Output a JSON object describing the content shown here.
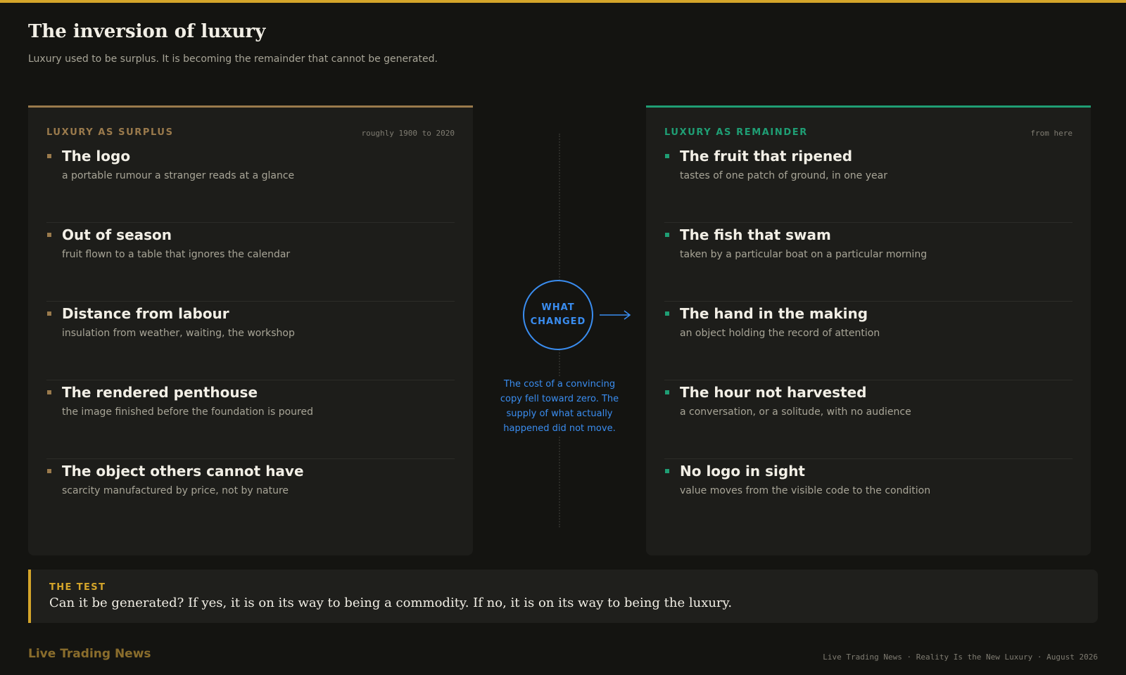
{
  "header": {
    "title": "The inversion of luxury",
    "subtitle": "Luxury used to be surplus. It is becoming the remainder that cannot be generated."
  },
  "colors": {
    "gold": "#d4a52a",
    "surplus": "#9a7a4c",
    "remainder": "#1f9e74",
    "change": "#3a8df0"
  },
  "surplus": {
    "label": "LUXURY AS SURPLUS",
    "range": "roughly 1900 to 2020",
    "items": [
      {
        "title": "The logo",
        "desc": "a portable rumour a stranger reads at a glance"
      },
      {
        "title": "Out of season",
        "desc": "fruit flown to a table that ignores the calendar"
      },
      {
        "title": "Distance from labour",
        "desc": "insulation from weather, waiting, the workshop"
      },
      {
        "title": "The rendered penthouse",
        "desc": "the image finished before the foundation is poured"
      },
      {
        "title": "The object others cannot have",
        "desc": "scarcity manufactured by price, not by nature"
      }
    ]
  },
  "remainder": {
    "label": "LUXURY AS REMAINDER",
    "range": "from here",
    "items": [
      {
        "title": "The fruit that ripened",
        "desc": "tastes of one patch of ground, in one year"
      },
      {
        "title": "The fish that swam",
        "desc": "taken by a particular boat on a particular morning"
      },
      {
        "title": "The hand in the making",
        "desc": "an object holding the record of attention"
      },
      {
        "title": "The hour not harvested",
        "desc": "a conversation, or a solitude, with no audience"
      },
      {
        "title": "No logo in sight",
        "desc": "value moves from the visible code to the condition"
      }
    ]
  },
  "change": {
    "line1": "WHAT",
    "line2": "CHANGED",
    "note": "The cost of a convincing copy fell toward zero. The supply of what actually happened did not move."
  },
  "test": {
    "label": "THE TEST",
    "text": "Can it be generated? If yes, it is on its way to being a commodity. If no, it is on its way to being the luxury."
  },
  "footer": {
    "brand": "Live Trading News",
    "meta": "Live Trading News · Reality Is the New Luxury · August 2026"
  }
}
